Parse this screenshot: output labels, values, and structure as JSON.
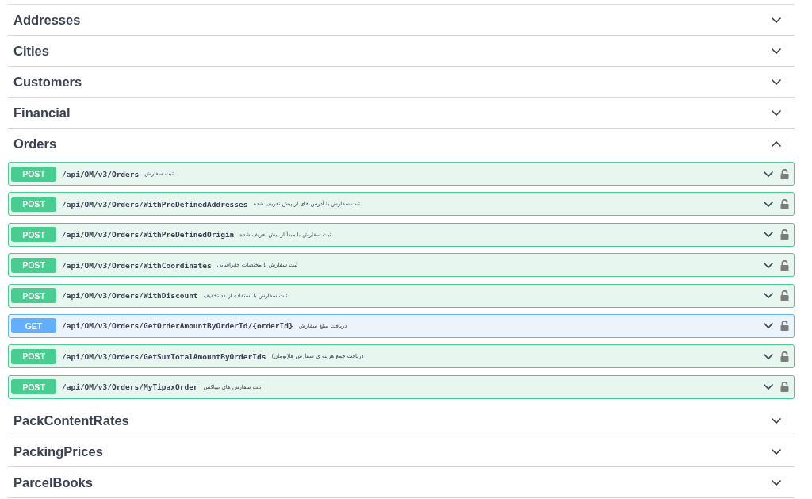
{
  "sections": [
    {
      "name": "Addresses",
      "expanded": false
    },
    {
      "name": "Cities",
      "expanded": false
    },
    {
      "name": "Customers",
      "expanded": false
    },
    {
      "name": "Financial",
      "expanded": false
    },
    {
      "name": "Orders",
      "expanded": true,
      "operations": [
        {
          "method": "POST",
          "kind": "post",
          "path": "/api/OM/v3/Orders",
          "summary": "ثبت سفارش"
        },
        {
          "method": "POST",
          "kind": "post",
          "path": "/api/OM/v3/Orders/WithPreDefinedAddresses",
          "summary": "ثبت سفارش با آدرس های از پیش تعریف شده"
        },
        {
          "method": "POST",
          "kind": "post",
          "path": "/api/OM/v3/Orders/WithPreDefinedOrigin",
          "summary": "ثبت سفارش با مبدأ از پیش تعریف شده"
        },
        {
          "method": "POST",
          "kind": "post",
          "path": "/api/OM/v3/Orders/WithCoordinates",
          "summary": "ثبت سفارش با مختصات جغرافیایی"
        },
        {
          "method": "POST",
          "kind": "post",
          "path": "/api/OM/v3/Orders/WithDiscount",
          "summary": "ثبت سفارش با استفاده از کد تخفیف"
        },
        {
          "method": "GET",
          "kind": "get",
          "path": "/api/OM/v3/Orders/GetOrderAmountByOrderId/{orderId}",
          "summary": "دریافت مبلغ سفارش"
        },
        {
          "method": "POST",
          "kind": "post",
          "path": "/api/OM/v3/Orders/GetSumTotalAmountByOrderIds",
          "summary": "دریافت جمع هزینه ی سفارش ها(تومان)"
        },
        {
          "method": "POST",
          "kind": "post",
          "path": "/api/OM/v3/Orders/MyTipaxOrder",
          "summary": "ثبت سفارش های تیپاکس"
        }
      ]
    },
    {
      "name": "PackContentRates",
      "expanded": false
    },
    {
      "name": "PackingPrices",
      "expanded": false
    },
    {
      "name": "ParcelBooks",
      "expanded": false
    }
  ]
}
